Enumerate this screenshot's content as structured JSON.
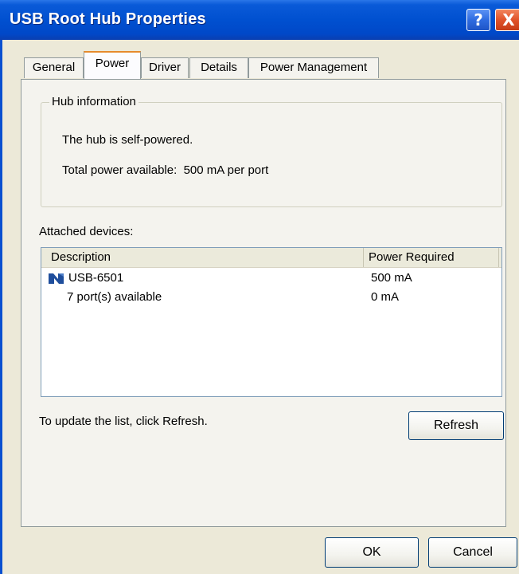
{
  "window": {
    "title": "USB Root Hub Properties",
    "help_label": "?",
    "close_label": "X"
  },
  "tabs": [
    {
      "label": "General",
      "active": false
    },
    {
      "label": "Power",
      "active": true
    },
    {
      "label": "Driver",
      "active": false
    },
    {
      "label": "Details",
      "active": false
    },
    {
      "label": "Power Management",
      "active": false
    }
  ],
  "hub_info": {
    "legend": "Hub information",
    "line1": "The hub is self-powered.",
    "line2": "Total power available:  500 mA per port"
  },
  "attached": {
    "label": "Attached devices:",
    "columns": {
      "description": "Description",
      "power": "Power Required"
    },
    "rows": [
      {
        "description": "USB-6501",
        "power": "500 mA",
        "icon": "ni-device-icon"
      },
      {
        "description": "7 port(s) available",
        "power": "0 mA",
        "icon": ""
      }
    ]
  },
  "update_hint": "To update the list, click Refresh.",
  "buttons": {
    "refresh": "Refresh",
    "ok": "OK",
    "cancel": "Cancel"
  },
  "colors": {
    "titlebar": "#0050D0",
    "active_tab_accent": "#E68B2C",
    "dialog_bg": "#ECE9D8"
  }
}
